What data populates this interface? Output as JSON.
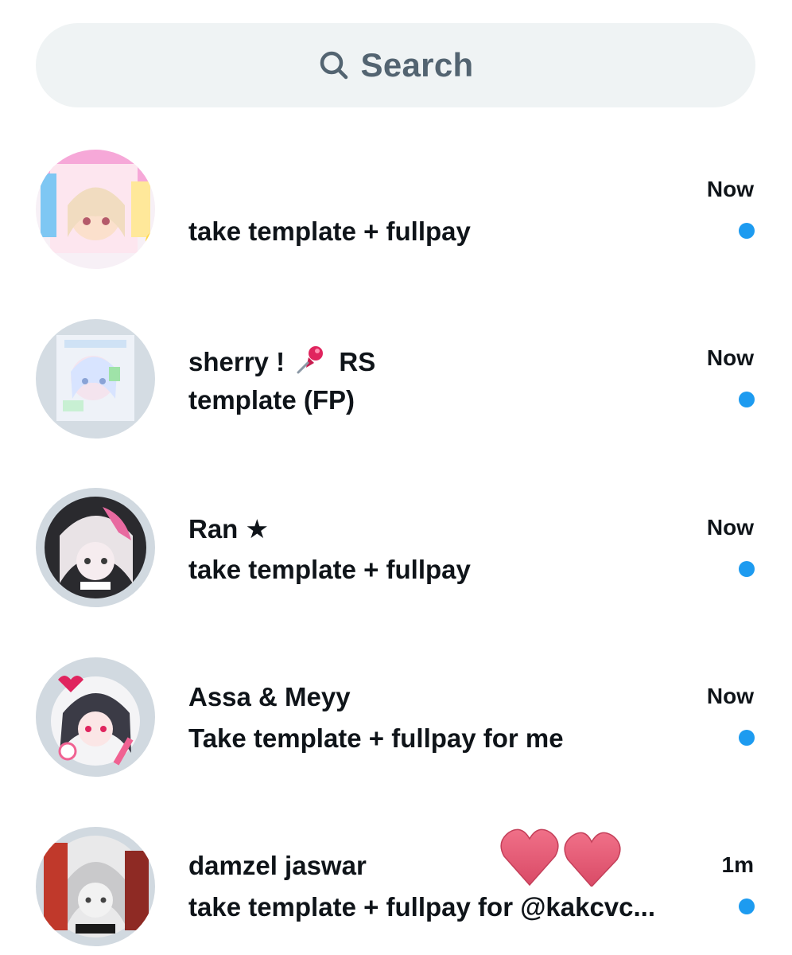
{
  "search": {
    "label": "Search",
    "icon": "search-icon"
  },
  "colors": {
    "unread": "#1d9bf0",
    "search_bg": "#eff3f4",
    "muted": "#536471"
  },
  "conversations": [
    {
      "name": "",
      "preview": "take template + fullpay",
      "time": "Now",
      "unread": true
    },
    {
      "name_part1": "sherry !",
      "name_icon": "pushpin-icon",
      "name_part2": "RS",
      "preview": "template (FP)",
      "time": "Now",
      "unread": true
    },
    {
      "name": "Ran ★",
      "preview": "take template + fullpay",
      "time": "Now",
      "unread": true
    },
    {
      "name": "Assa & Meyy",
      "preview": "Take template + fullpay for me",
      "time": "Now",
      "unread": true
    },
    {
      "name": "damzel jaswar",
      "preview": "take template + fullpay for @kakcvc...",
      "time": "1m",
      "unread": true
    }
  ],
  "overlay": {
    "icon": "two-hearts-sticker"
  }
}
